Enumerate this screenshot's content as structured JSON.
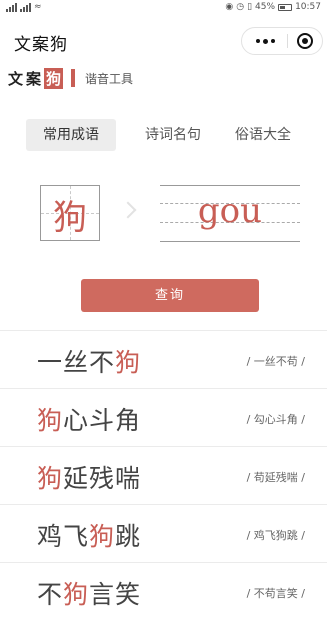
{
  "statusbar": {
    "battery_pct": "45%",
    "time": "10:57"
  },
  "navbar": {
    "title": "文案狗"
  },
  "brand": {
    "name_part": "文案",
    "name_highlight": "狗",
    "subtitle": "谐音工具"
  },
  "tabs": [
    {
      "label": "常用成语",
      "active": true
    },
    {
      "label": "诗词名句",
      "active": false
    },
    {
      "label": "俗语大全",
      "active": false
    }
  ],
  "query": {
    "character": "狗",
    "pinyin": "gou",
    "button_label": "查询"
  },
  "results": [
    {
      "pre": "一丝不",
      "hl": "狗",
      "post": "",
      "source": "/ 一丝不苟 /"
    },
    {
      "pre": "",
      "hl": "狗",
      "post": "心斗角",
      "source": "/ 勾心斗角 /"
    },
    {
      "pre": "",
      "hl": "狗",
      "post": "延残喘",
      "source": "/ 苟延残喘 /"
    },
    {
      "pre": "鸡飞",
      "hl": "狗",
      "post": "跳",
      "source": "/ 鸡飞狗跳 /"
    },
    {
      "pre": "不",
      "hl": "狗",
      "post": "言笑",
      "source": "/ 不苟言笑 /"
    }
  ],
  "colors": {
    "accent": "#c85e55",
    "button": "#cf6a5f"
  }
}
